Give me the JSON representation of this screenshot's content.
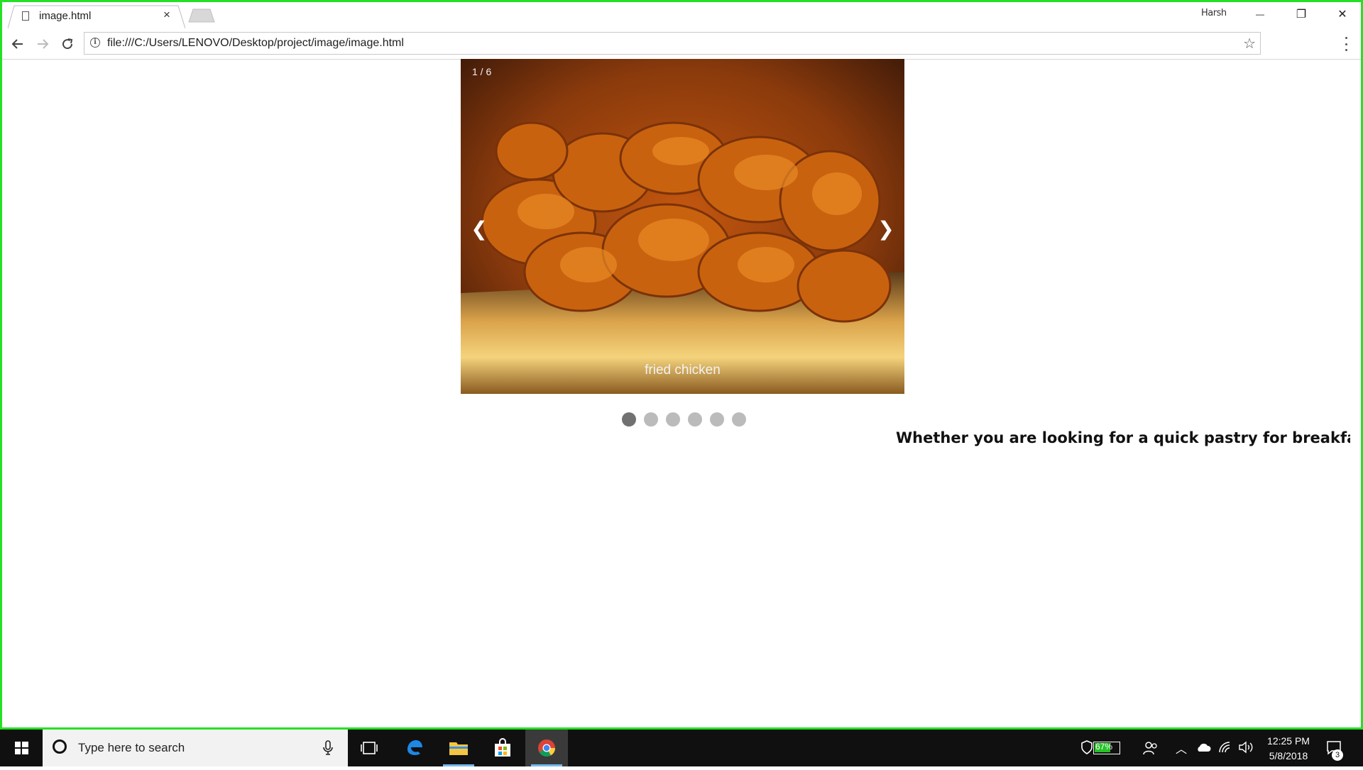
{
  "browser": {
    "tab_title": "image.html",
    "tab_close_glyph": "×",
    "profile_name": "Harsh",
    "url": "file:///C:/Users/LENOVO/Desktop/project/image/image.html",
    "bookmark_star": "☆",
    "info_glyph": "i"
  },
  "window_controls": {
    "minimize": "—",
    "restore": "❐",
    "close": "✕"
  },
  "slideshow": {
    "counter": "1 / 6",
    "prev": "❮",
    "next": "❯",
    "caption": "fried chicken",
    "image_description": "fried-chicken-photo",
    "dots": [
      {
        "label": "slide-1",
        "active": true
      },
      {
        "label": "slide-2",
        "active": false
      },
      {
        "label": "slide-3",
        "active": false
      },
      {
        "label": "slide-4",
        "active": false
      },
      {
        "label": "slide-5",
        "active": false
      },
      {
        "label": "slide-6",
        "active": false
      }
    ]
  },
  "page": {
    "marquee_text": "Whether you are looking for a quick pastry for breakfast, a"
  },
  "taskbar": {
    "search_placeholder": "Type here to search",
    "battery": "67%",
    "time": "12:25 PM",
    "date": "5/8/2018",
    "notifications": "3"
  },
  "colors": {
    "frame_border": "#25e025",
    "dot_active": "#717171",
    "dot_inactive": "#bbbbbb",
    "taskbar": "#101010"
  }
}
